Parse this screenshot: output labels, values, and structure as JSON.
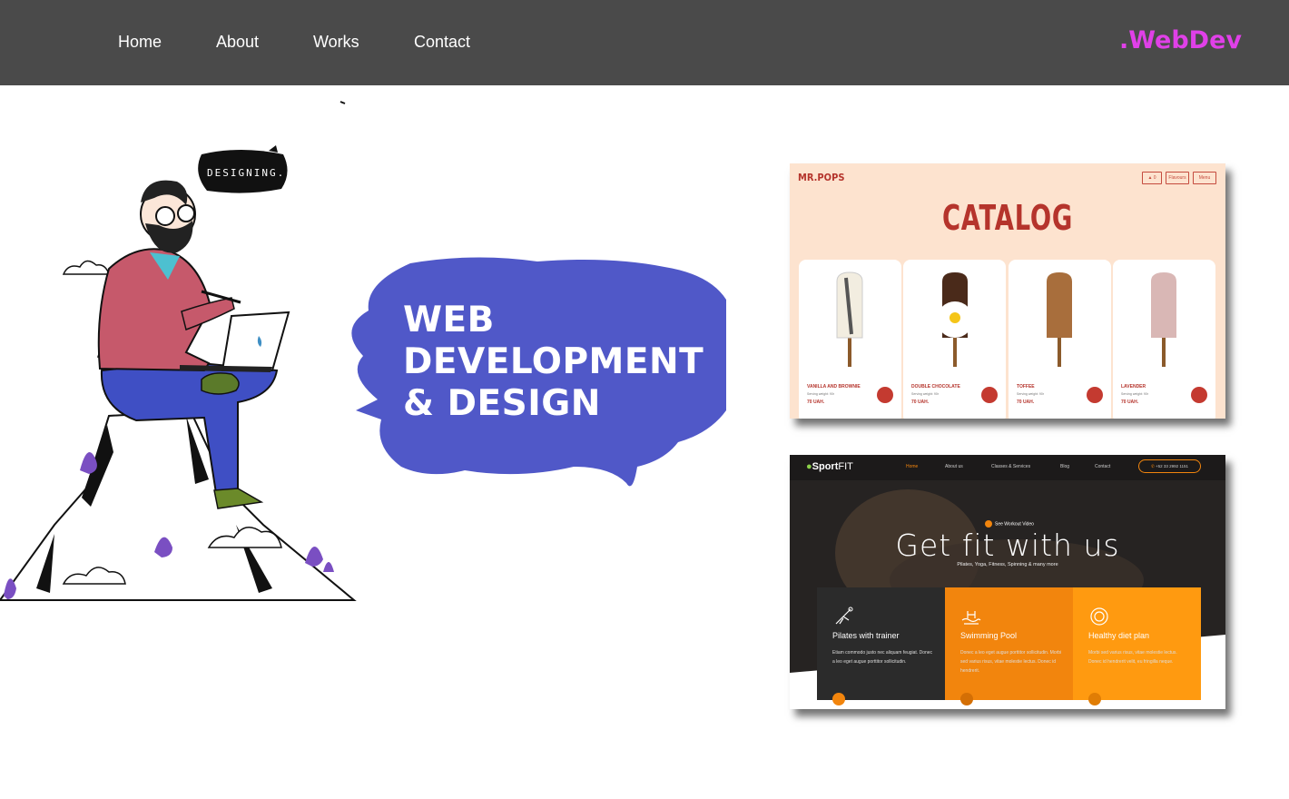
{
  "nav": {
    "links": [
      "Home",
      "About",
      "Works",
      "Contact"
    ],
    "brand": ".WebDev"
  },
  "hero": {
    "speech_bubble": "DESIGNING...",
    "headline": [
      "WEB",
      "DEVELOPMENT",
      "& DESIGN"
    ],
    "splash_color": "#5058c8"
  },
  "portfolio": [
    {
      "name": "mr-pops",
      "logo": "MR.POPS",
      "buttons": [
        "Flavours",
        "Menu"
      ],
      "title": "CATALOG",
      "items": [
        {
          "name": "VANILLA AND BROWNIE",
          "sub": "Serving weight: 90r",
          "price": "70 UAH."
        },
        {
          "name": "DOUBLE CHOCOLATE",
          "sub": "Serving weight: 90r",
          "price": "70 UAH."
        },
        {
          "name": "TOFFEE",
          "sub": "Serving weight: 90r",
          "price": "70 UAH."
        },
        {
          "name": "LAVENDER",
          "sub": "Serving weight: 90r",
          "price": "70 UAH."
        }
      ]
    },
    {
      "name": "sportfit",
      "logo_bold": "Sport",
      "logo_light": "FIT",
      "links": [
        "Home",
        "About us",
        "Classes & Services",
        "Blog",
        "Contact"
      ],
      "phone": "+52 33 2992 1151",
      "video_label": "See Workout Video",
      "title": "Get fit with us",
      "subtitle": "Pilates, Yoga, Fitness, Spinning & many more",
      "panels": [
        {
          "title": "Pilates with trainer",
          "text": "Etiam commodo justo nec aliquam feugiat. Donec a leo eget augue porttitor sollicitudin."
        },
        {
          "title": "Swimming Pool",
          "text": "Donec a leo eget augue porttitor sollicitudin. Morbi sed varius risus, vitae molestie lectus. Donec id hendrerit."
        },
        {
          "title": "Healthy diet plan",
          "text": "Morbi sed varius risus, vitae molestie lectus. Donec id hendrerit velit, eu fringilla neque."
        }
      ]
    }
  ],
  "colors": {
    "navbar": "#4a4a4a",
    "brand": "#e040e8",
    "accent_orange": "#f2850d",
    "pops_red": "#b5342c"
  }
}
